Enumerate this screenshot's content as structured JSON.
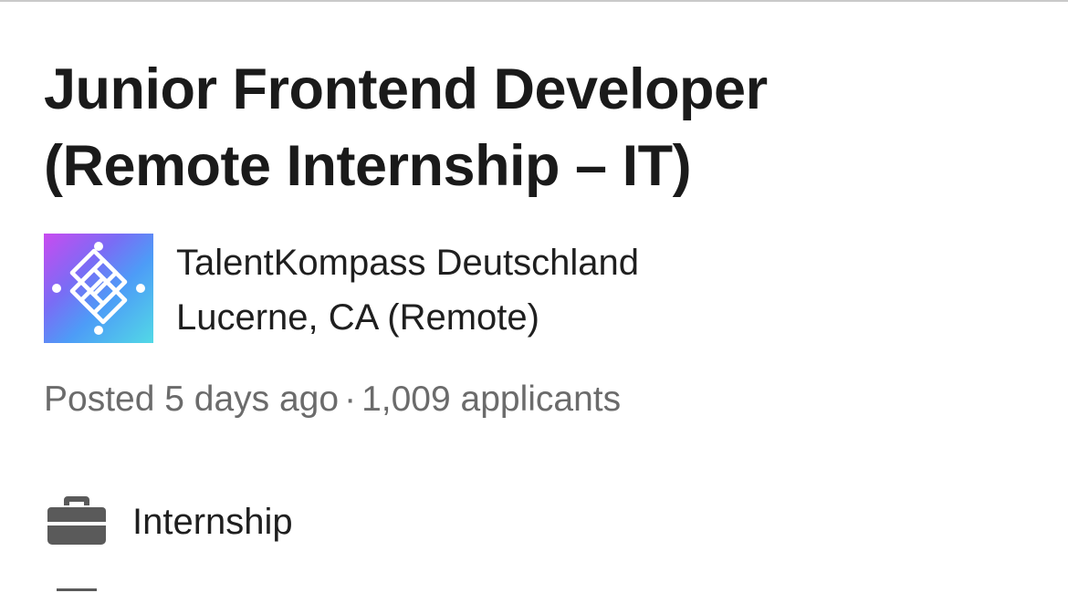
{
  "job": {
    "title_line1": "Junior Frontend Developer",
    "title_line2": "(Remote Internship – IT)"
  },
  "company": {
    "name": "TalentKompass Deutschland",
    "location": "Lucerne, CA (Remote)",
    "logo_icon": "interlocking-squares-logo"
  },
  "meta": {
    "posted": "Posted 5 days ago",
    "separator": "·",
    "applicants": "1,009 applicants"
  },
  "details": {
    "job_type_icon": "briefcase-icon",
    "job_type": "Internship"
  },
  "colors": {
    "title": "#1a1a1a",
    "text": "#1f1f1f",
    "muted": "#6b6b6b",
    "icon": "#5a5a5a",
    "logo_gradient": [
      "#c94bf0",
      "#7a6cf5",
      "#4d9cf7",
      "#52d9e6"
    ]
  }
}
